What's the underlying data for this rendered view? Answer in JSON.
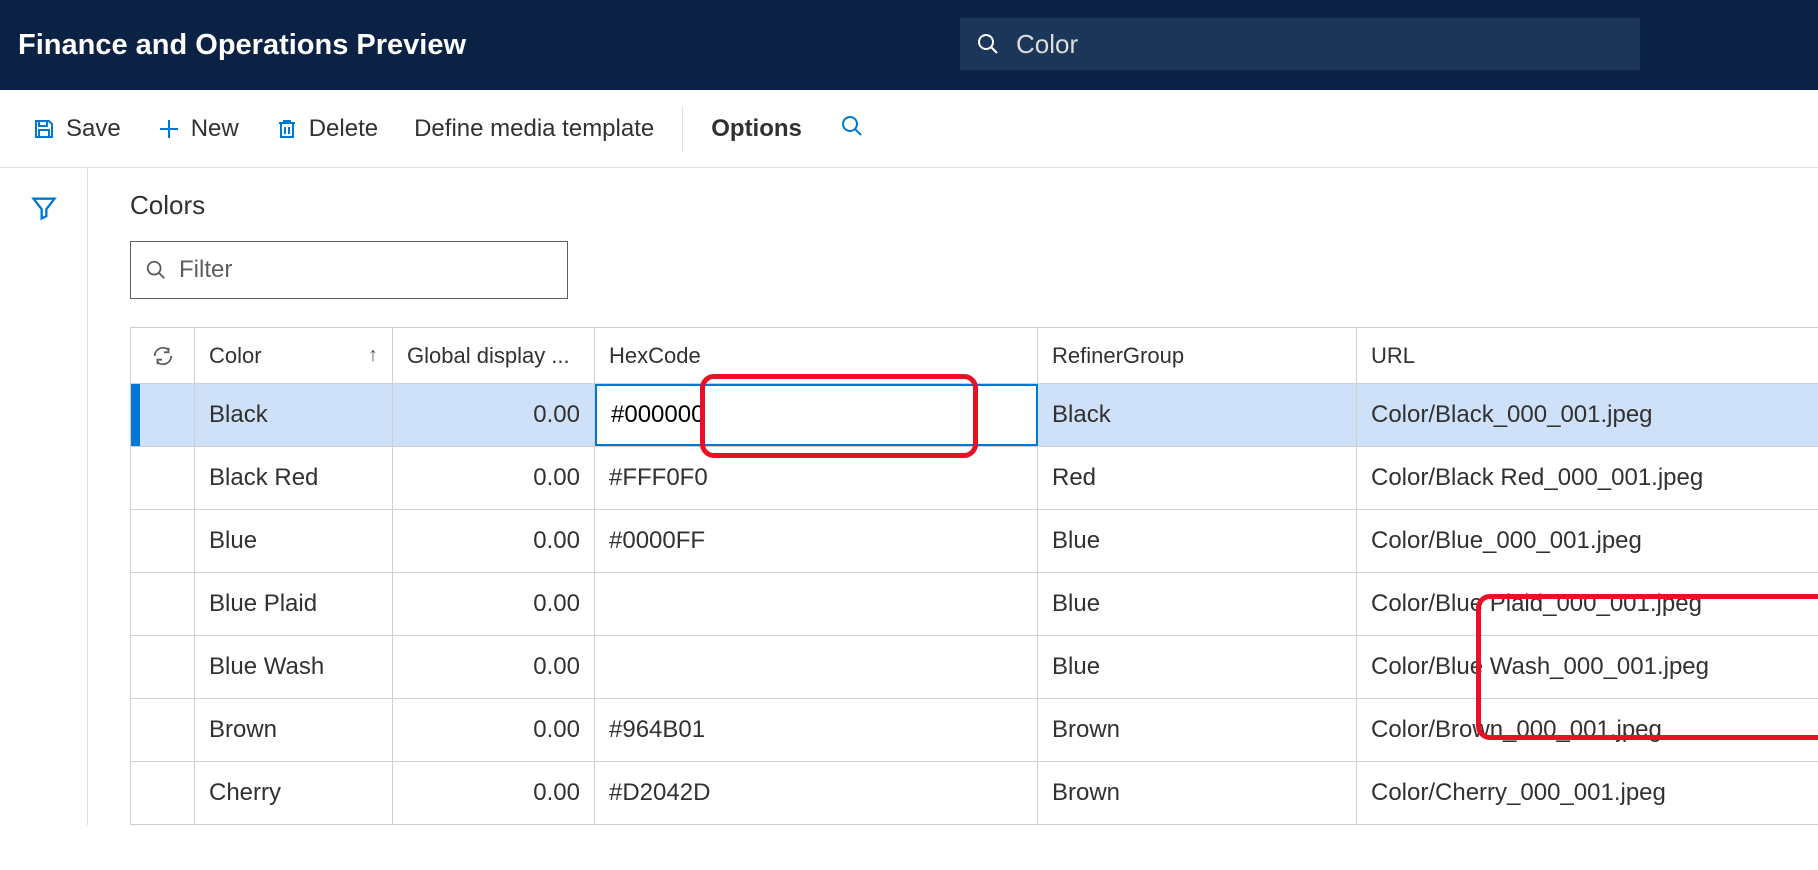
{
  "header": {
    "title": "Finance and Operations Preview",
    "search_value": "Color"
  },
  "toolbar": {
    "save": "Save",
    "new": "New",
    "delete": "Delete",
    "define_media": "Define media template",
    "options": "Options"
  },
  "section": {
    "title": "Colors",
    "filter_placeholder": "Filter"
  },
  "grid": {
    "columns": {
      "color": "Color",
      "global_display": "Global display ...",
      "hexcode": "HexCode",
      "refiner": "RefinerGroup",
      "url": "URL"
    },
    "rows": [
      {
        "color": "Black",
        "gdo": "0.00",
        "hex": "#000000",
        "refiner": "Black",
        "url": "Color/Black_000_001.jpeg",
        "selected": true
      },
      {
        "color": "Black Red",
        "gdo": "0.00",
        "hex": "#FFF0F0",
        "refiner": "Red",
        "url": "Color/Black Red_000_001.jpeg"
      },
      {
        "color": "Blue",
        "gdo": "0.00",
        "hex": "#0000FF",
        "refiner": "Blue",
        "url": "Color/Blue_000_001.jpeg"
      },
      {
        "color": "Blue Plaid",
        "gdo": "0.00",
        "hex": "",
        "refiner": "Blue",
        "url": "Color/Blue Plaid_000_001.jpeg"
      },
      {
        "color": "Blue Wash",
        "gdo": "0.00",
        "hex": "",
        "refiner": "Blue",
        "url": "Color/Blue Wash_000_001.jpeg"
      },
      {
        "color": "Brown",
        "gdo": "0.00",
        "hex": "#964B01",
        "refiner": "Brown",
        "url": "Color/Brown_000_001.jpeg"
      },
      {
        "color": "Cherry",
        "gdo": "0.00",
        "hex": "#D2042D",
        "refiner": "Brown",
        "url": "Color/Cherry_000_001.jpeg"
      }
    ]
  }
}
